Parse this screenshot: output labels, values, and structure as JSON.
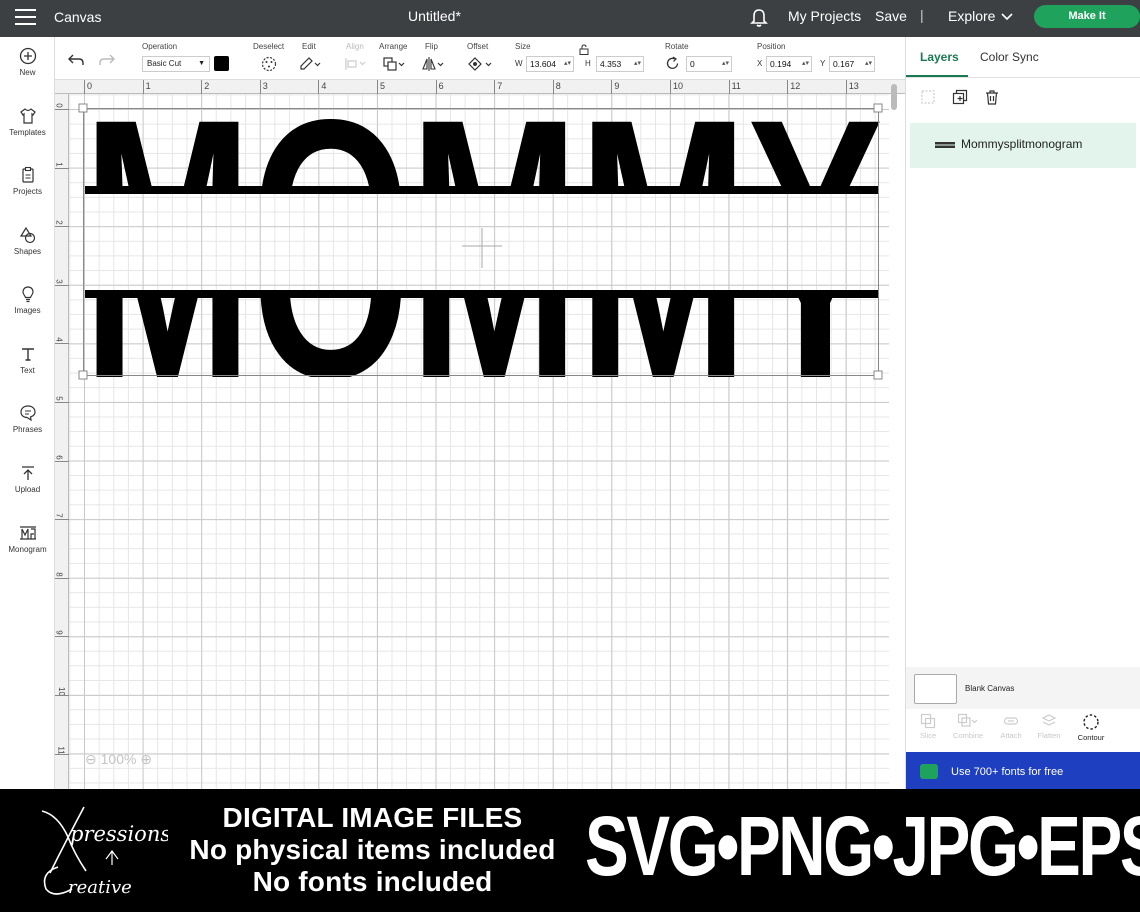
{
  "topbar": {
    "app_title": "Canvas",
    "doc_title": "Untitled*",
    "nav": [
      "My Projects",
      "Save",
      "Explore"
    ],
    "separator": "|",
    "make_it": "Make It"
  },
  "left_panel": {
    "items": [
      {
        "label": "New",
        "icon": "plus-circle-icon"
      },
      {
        "label": "Templates",
        "icon": "shirt-icon"
      },
      {
        "label": "Projects",
        "icon": "clipboard-icon"
      },
      {
        "label": "Shapes",
        "icon": "shapes-icon"
      },
      {
        "label": "Images",
        "icon": "lightbulb-icon"
      },
      {
        "label": "Text",
        "icon": "text-t-icon"
      },
      {
        "label": "Phrases",
        "icon": "speech-bubble-icon"
      },
      {
        "label": "Upload",
        "icon": "upload-icon"
      },
      {
        "label": "Monogram",
        "icon": "monogram-icon"
      }
    ]
  },
  "toolbar": {
    "operation_label": "Operation",
    "operation_value": "Basic Cut",
    "operation_color": "#000000",
    "deselect_label": "Deselect",
    "edit_label": "Edit",
    "align_label": "Align",
    "arrange_label": "Arrange",
    "flip_label": "Flip",
    "offset_label": "Offset",
    "size_label": "Size",
    "w_label": "W",
    "w_value": "13.604",
    "h_label": "H",
    "h_value": "4.353",
    "rotate_label": "Rotate",
    "rotate_value": "0",
    "position_label": "Position",
    "x_label": "X",
    "x_value": "0.194",
    "y_label": "Y",
    "y_value": "0.167"
  },
  "canvas": {
    "ruler_top": [
      "0",
      "1",
      "2",
      "3",
      "4",
      "5",
      "6",
      "7",
      "8",
      "9",
      "10",
      "11",
      "12",
      "13"
    ],
    "ruler_left": [
      "0",
      "1",
      "2",
      "3",
      "4",
      "5",
      "6",
      "7",
      "8",
      "9",
      "10",
      "11"
    ],
    "zoom": "100%",
    "design_top_text": "MOMMY",
    "design_bottom_text": "MOMMY"
  },
  "right_panel": {
    "tabs": [
      "Layers",
      "Color Sync"
    ],
    "layer_name": "Mommysplitmonogram",
    "blank_canvas": "Blank Canvas",
    "bottom_tools": [
      "Slice",
      "Combine",
      "Attach",
      "Flatten",
      "Contour"
    ],
    "fonts_banner": "Use 700+ fonts for free"
  },
  "banner": {
    "line1": "DIGITAL IMAGE FILES",
    "line2": "No physical items included",
    "line3": "No fonts included",
    "formats": "SVG•PNG•JPG•EPS",
    "logo_text": "Xpressions Creative"
  }
}
